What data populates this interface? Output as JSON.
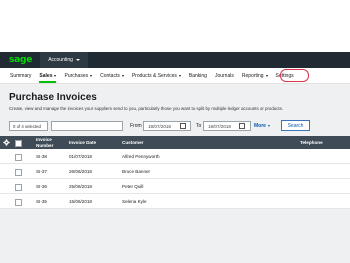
{
  "topbar": {
    "logo": "sage",
    "app_switch_label": "Accounting"
  },
  "nav": {
    "items": [
      {
        "label": "Summary",
        "active": false,
        "dropdown": false
      },
      {
        "label": "Sales",
        "active": true,
        "dropdown": true
      },
      {
        "label": "Purchases",
        "active": false,
        "dropdown": true
      },
      {
        "label": "Contacts",
        "active": false,
        "dropdown": true
      },
      {
        "label": "Products & Services",
        "active": false,
        "dropdown": true
      },
      {
        "label": "Banking",
        "active": false,
        "dropdown": false
      },
      {
        "label": "Journals",
        "active": false,
        "dropdown": false
      },
      {
        "label": "Reporting",
        "active": false,
        "dropdown": true
      },
      {
        "label": "Settings",
        "active": false,
        "dropdown": false
      }
    ]
  },
  "page": {
    "title": "Purchase Invoices",
    "description": "Create, view and manage the invoices your suppliers send to you, particularly those you want to split by multiple ledger accounts or products."
  },
  "filters": {
    "selection_count": "0 of 4 selected",
    "search_value": "",
    "from_label": "From",
    "from_date": "18/07/2018",
    "to_label": "To",
    "to_date": "18/07/2018",
    "more_label": "More",
    "search_button": "Search"
  },
  "table": {
    "columns": [
      "Invoice Number",
      "Invoice Date",
      "Customer",
      "Telephone"
    ],
    "rows": [
      {
        "invoice_number": "SI-38",
        "invoice_date": "01/07/2018",
        "customer": "Alfred Pennyworth",
        "telephone": ""
      },
      {
        "invoice_number": "SI-37",
        "invoice_date": "26/06/2018",
        "customer": "Bruce Banner",
        "telephone": ""
      },
      {
        "invoice_number": "SI-36",
        "invoice_date": "25/06/2018",
        "customer": "Peter Quill",
        "telephone": ""
      },
      {
        "invoice_number": "SI-35",
        "invoice_date": "15/06/2018",
        "customer": "Selena Kyle",
        "telephone": ""
      }
    ]
  },
  "colors": {
    "brand_green": "#00dc00",
    "topbar_bg": "#1f2a33",
    "table_header_bg": "#3f4c57",
    "link_blue": "#0b5cad",
    "highlight_red": "#d9364a"
  }
}
